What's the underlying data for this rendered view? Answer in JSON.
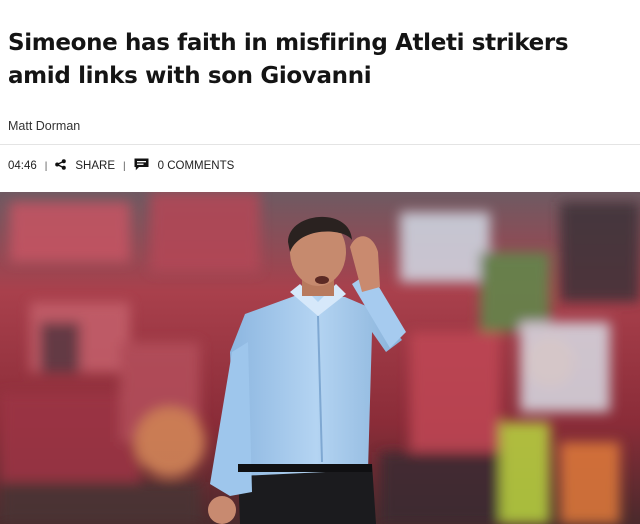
{
  "article": {
    "headline": "Simeone has faith in misfiring Atleti strikers amid links with son Giovanni",
    "author": "Matt Dorman",
    "time": "04:46",
    "share_label": "SHARE",
    "comments_label": "0 COMMENTS"
  },
  "icons": {
    "share": "share-icon",
    "comments": "comment-icon"
  },
  "colors": {
    "text": "#141414",
    "stadium_seats": "#b6424f",
    "shirt": "#9ec6ec"
  }
}
